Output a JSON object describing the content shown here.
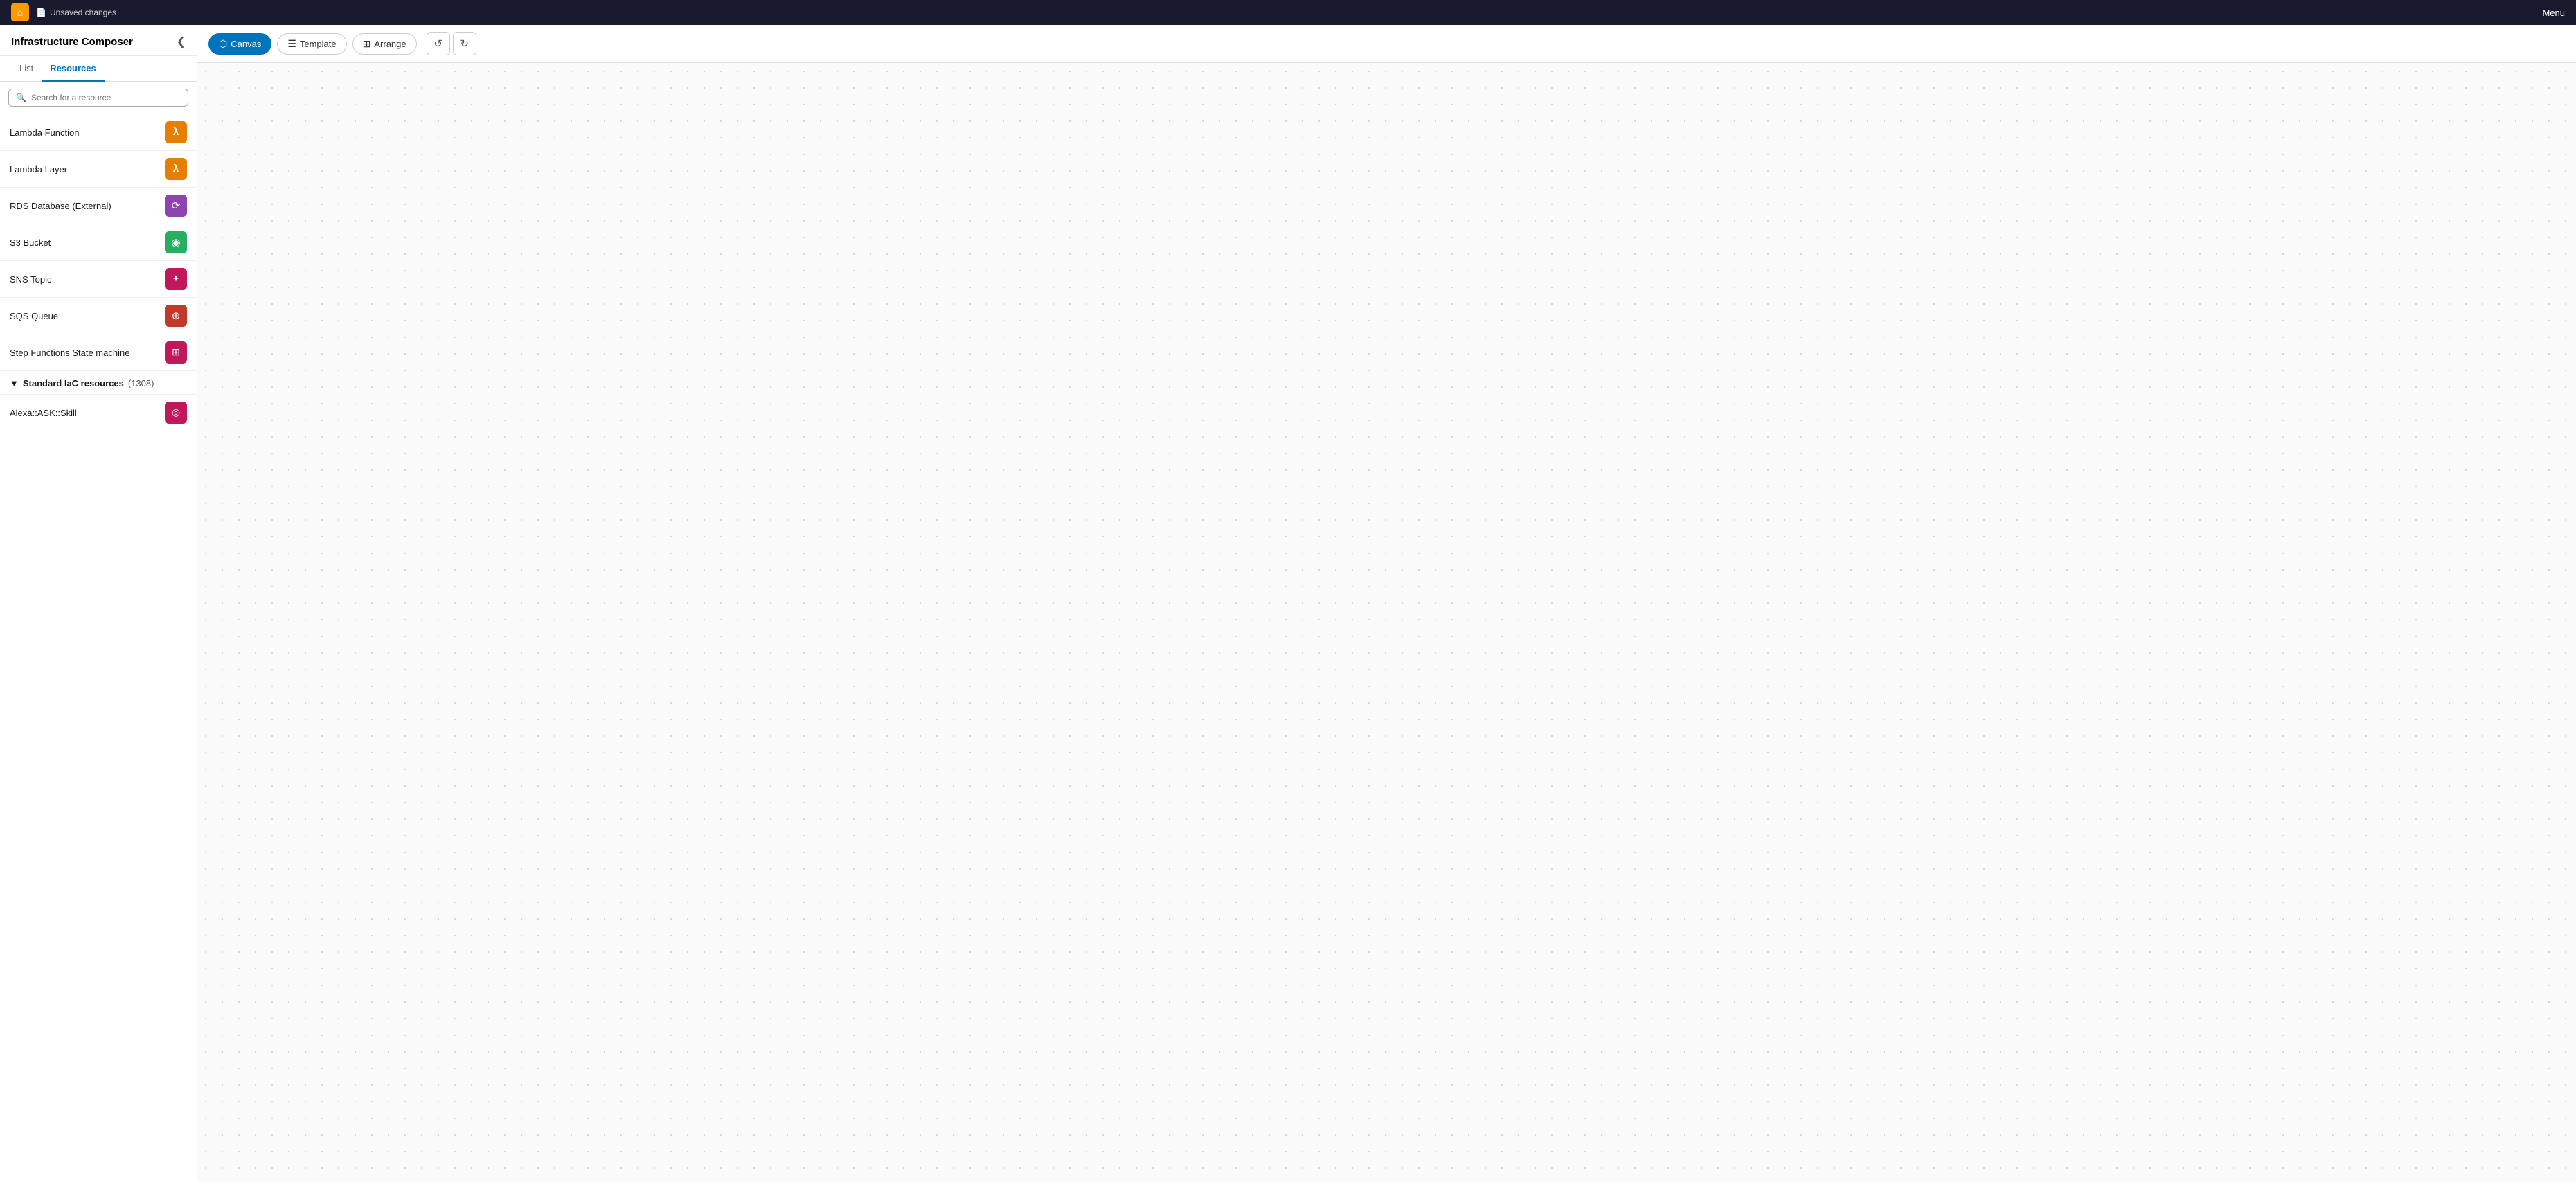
{
  "topbar": {
    "unsaved_label": "Unsaved changes",
    "menu_label": "Menu"
  },
  "sidebar": {
    "title": "Infrastructure Composer",
    "tabs": [
      {
        "id": "list",
        "label": "List"
      },
      {
        "id": "resources",
        "label": "Resources",
        "active": true
      }
    ]
  },
  "search": {
    "placeholder": "Search for a resource"
  },
  "resources": [
    {
      "name": "Lambda Function",
      "icon_class": "icon-orange lambda-icon"
    },
    {
      "name": "Lambda Layer",
      "icon_class": "icon-orange lambda-icon"
    },
    {
      "name": "RDS Database (External)",
      "icon_class": "icon-purple rds-icon"
    },
    {
      "name": "S3 Bucket",
      "icon_class": "icon-green s3-icon"
    },
    {
      "name": "SNS Topic",
      "icon_class": "icon-magenta sns-icon"
    },
    {
      "name": "SQS Queue",
      "icon_class": "icon-pink sqs-icon"
    },
    {
      "name": "Step Functions State machine",
      "icon_class": "icon-magenta sf-icon"
    }
  ],
  "standard_iac": {
    "label": "Standard IaC resources",
    "count": "(1308)"
  },
  "alexa": {
    "name": "Alexa::ASK::Skill",
    "icon_class": "icon-magenta alexa-icon"
  },
  "toolbar": {
    "canvas_label": "Canvas",
    "template_label": "Template",
    "arrange_label": "Arrange"
  }
}
